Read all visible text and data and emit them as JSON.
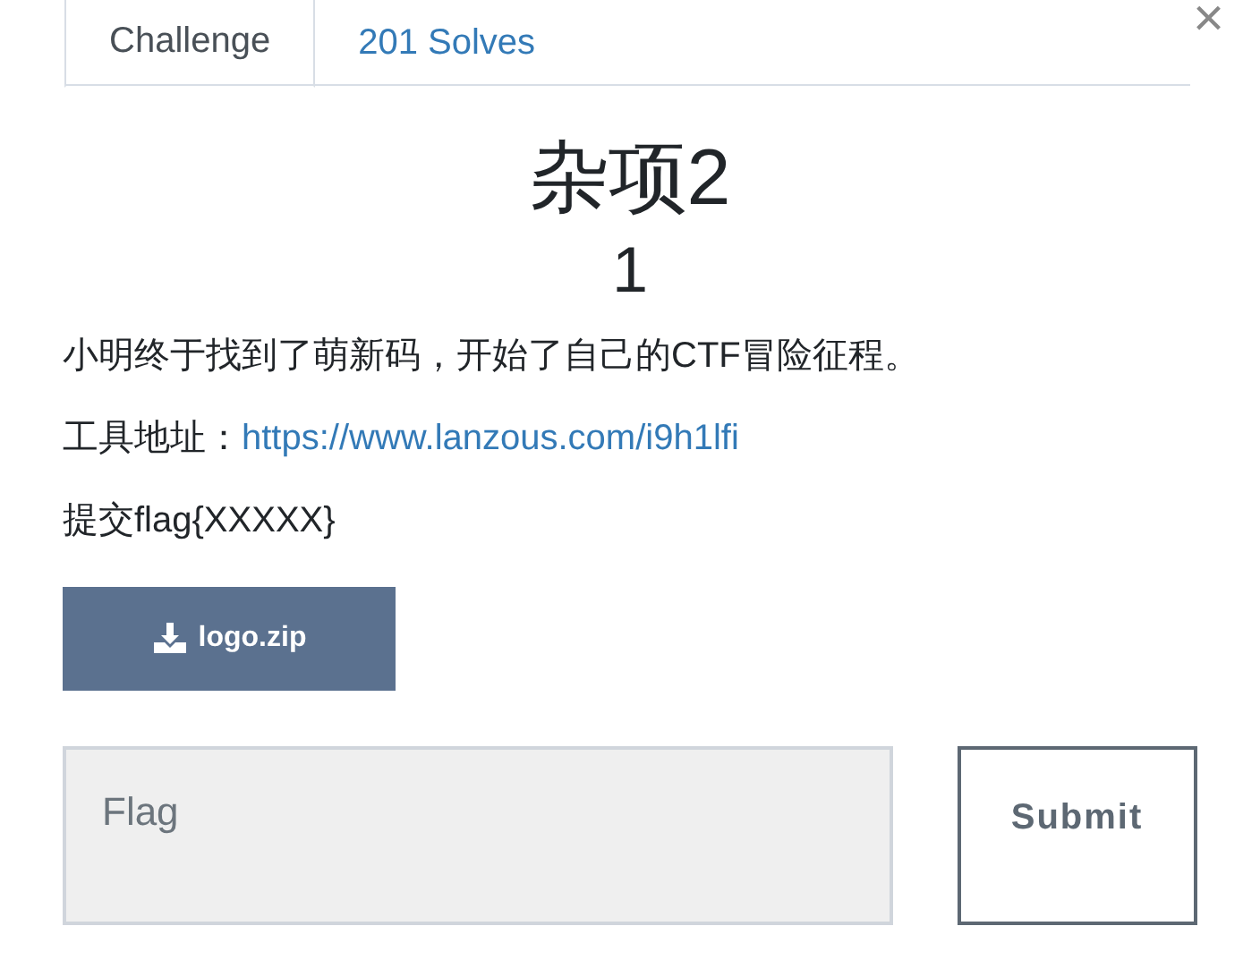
{
  "close": "×",
  "tabs": [
    {
      "label": "Challenge",
      "selected": true
    },
    {
      "label": "201 Solves",
      "selected": false
    }
  ],
  "title": "杂项2",
  "value": "1",
  "description": [
    {
      "kind": "text",
      "text": "小明终于找到了萌新码，开始了自己的CTF冒险征程。"
    },
    {
      "kind": "link",
      "text": "工具地址：",
      "link": "https://www.lanzous.com/i9h1lfi"
    },
    {
      "kind": "text",
      "text": "提交flag{XXXXX}"
    }
  ],
  "download": "logo.zip",
  "flag_field": {
    "placeholder": "Flag"
  },
  "submit": "Submit"
}
